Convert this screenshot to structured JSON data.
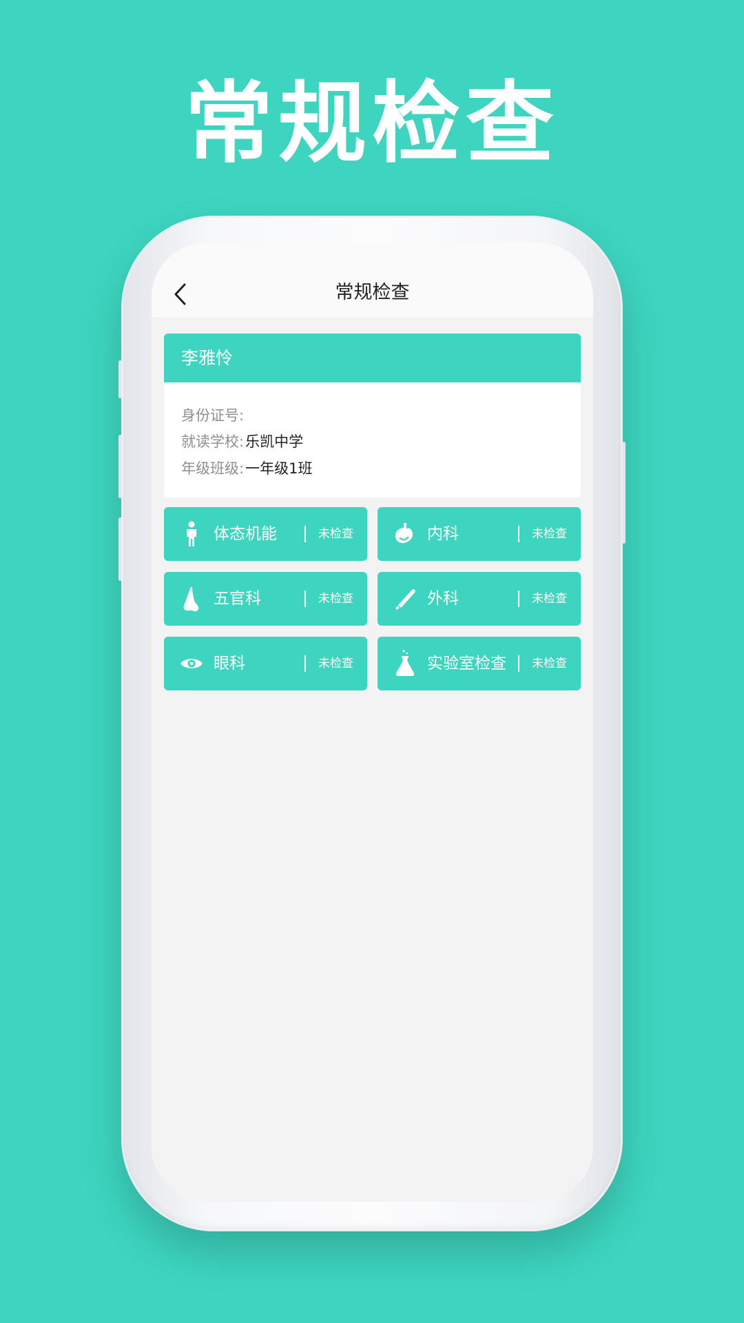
{
  "promo": {
    "title": "常规检查"
  },
  "navbar": {
    "title": "常规检查"
  },
  "student": {
    "name": "李雅怜",
    "id_label": "身份证号:",
    "id_value": "",
    "school_label": "就读学校:",
    "school_value": "乐凯中学",
    "grade_label": "年级班级:",
    "grade_value": "一年级1班"
  },
  "exams": [
    {
      "name": "体态机能",
      "status": "未检查",
      "icon": "person-icon"
    },
    {
      "name": "内科",
      "status": "未检查",
      "icon": "stomach-icon"
    },
    {
      "name": "五官科",
      "status": "未检查",
      "icon": "nose-icon"
    },
    {
      "name": "外科",
      "status": "未检查",
      "icon": "scalpel-icon"
    },
    {
      "name": "眼科",
      "status": "未检查",
      "icon": "eye-icon"
    },
    {
      "name": "实验室检查",
      "status": "未检查",
      "icon": "flask-icon"
    }
  ],
  "colors": {
    "accent": "#3dd5bf",
    "screen_bg": "#f3f3f3"
  }
}
